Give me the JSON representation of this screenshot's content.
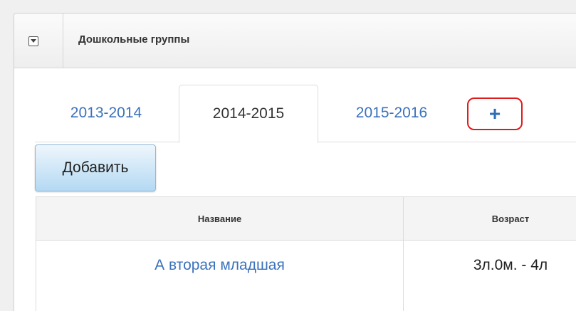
{
  "panel": {
    "title": "Дошкольные группы"
  },
  "tabs": {
    "items": [
      {
        "label": "2013-2014",
        "active": false
      },
      {
        "label": "2014-2015",
        "active": true
      },
      {
        "label": "2015-2016",
        "active": false
      }
    ],
    "add_label": "+"
  },
  "toolbar": {
    "add_button_label": "Добавить"
  },
  "table": {
    "columns": [
      "Название",
      "Возраст"
    ],
    "rows": [
      {
        "name": "А вторая младшая",
        "age": "3л.0м. - 4л"
      }
    ]
  },
  "colors": {
    "link": "#3a72bc",
    "highlight_border": "#e01b1b",
    "button_top": "#eef6fc",
    "button_bottom": "#b4d9f3"
  },
  "icons": {
    "collapse": "chevron-down-icon"
  }
}
